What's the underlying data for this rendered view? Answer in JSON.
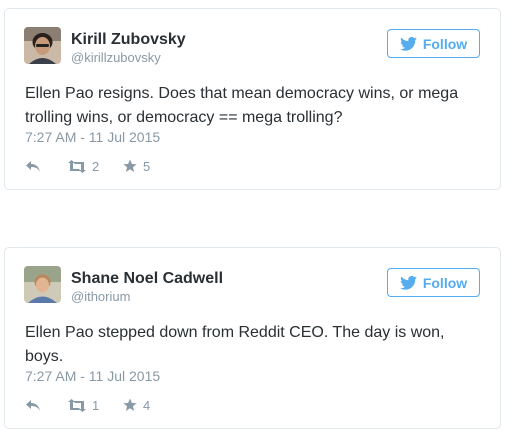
{
  "tweets": [
    {
      "name": "Kirill Zubovsky",
      "handle": "@kirillzubovsky",
      "follow_label": "Follow",
      "text": "Ellen Pao resigns. Does that mean democracy wins, or mega trolling wins, or democracy == mega trolling?",
      "timestamp": "7:27 AM - 11 Jul 2015",
      "retweets": "2",
      "favorites": "5"
    },
    {
      "name": "Shane Noel Cadwell",
      "handle": "@ithorium",
      "follow_label": "Follow",
      "text": "Ellen Pao stepped down from Reddit CEO. The day is won, boys.",
      "timestamp": "7:27 AM - 11 Jul 2015",
      "retweets": "1",
      "favorites": "4"
    }
  ],
  "colors": {
    "accent": "#55acee",
    "muted": "#8899a6",
    "text": "#292f33",
    "border": "#e1e8ed"
  },
  "icons": [
    "twitter-bird-icon",
    "reply-icon",
    "retweet-icon",
    "star-icon"
  ]
}
